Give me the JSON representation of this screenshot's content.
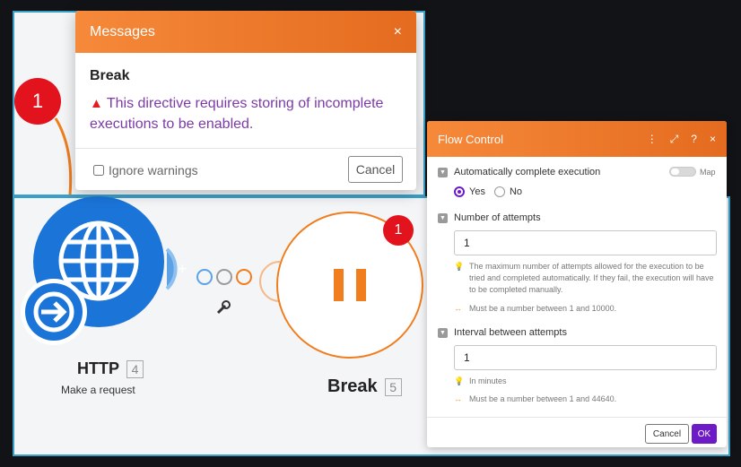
{
  "messages": {
    "title": "Messages",
    "close": "×",
    "heading": "Break",
    "warning_icon": "warning-icon",
    "warning_text": "This directive requires storing of incomplete executions to be enabled.",
    "ignore_label": "Ignore warnings",
    "cancel_label": "Cancel"
  },
  "error_badge_count": "1",
  "nodes": {
    "http": {
      "title": "HTTP",
      "id": "4",
      "subtitle": "Make a request",
      "color": "#1b75d9"
    },
    "break": {
      "title": "Break",
      "id": "5",
      "badge": "1",
      "color": "#f07d1e"
    }
  },
  "flow_control": {
    "title": "Flow Control",
    "tools": {
      "menu": "⋮",
      "expand": "⤢",
      "help": "?",
      "close": "×"
    },
    "auto_complete": {
      "label": "Automatically complete execution",
      "map_label": "Map",
      "options": [
        "Yes",
        "No"
      ],
      "selected": "Yes"
    },
    "attempts": {
      "label": "Number of attempts",
      "value": "1",
      "hint": "The maximum number of attempts allowed for the execution to be tried and completed automatically. If they fail, the execution will have to be completed manually.",
      "range": "Must be a number between 1 and 10000."
    },
    "interval": {
      "label": "Interval between attempts",
      "value": "1",
      "hint": "In minutes",
      "range": "Must be a number between 1 and 44640."
    },
    "cancel_label": "Cancel",
    "ok_label": "OK"
  },
  "colors": {
    "accent_orange": "#f07d1e",
    "accent_purple": "#6d1bc7",
    "error_red": "#e2131d",
    "selection_blue": "#3aa0c9"
  }
}
